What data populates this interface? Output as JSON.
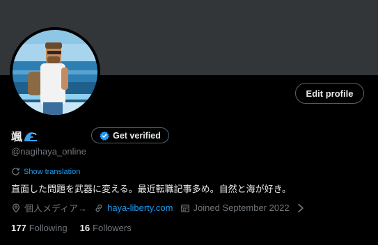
{
  "profile": {
    "display_name": "颯",
    "handle": "@nagihaya_online",
    "edit_label": "Edit profile",
    "verify_label": "Get verified",
    "translation_label": "Show translation",
    "bio": "直面した問題を武器に変える。最近転職記事多め。自然と海が好き。",
    "location": "個人メディア→",
    "website": "haya-liberty.com",
    "joined": "Joined September 2022",
    "following_count": "177",
    "following_label": "Following",
    "followers_count": "16",
    "followers_label": "Followers"
  },
  "icons": {
    "verify": "verified-badge-icon",
    "translate": "translate-icon",
    "location": "location-pin-icon",
    "link": "link-icon",
    "calendar": "calendar-icon",
    "wave": "wave-emoji-icon"
  },
  "colors": {
    "background": "#000000",
    "banner": "#333639",
    "text": "#e7e9ea",
    "muted": "#71767b",
    "accent": "#1d9bf0",
    "border": "#536471"
  }
}
